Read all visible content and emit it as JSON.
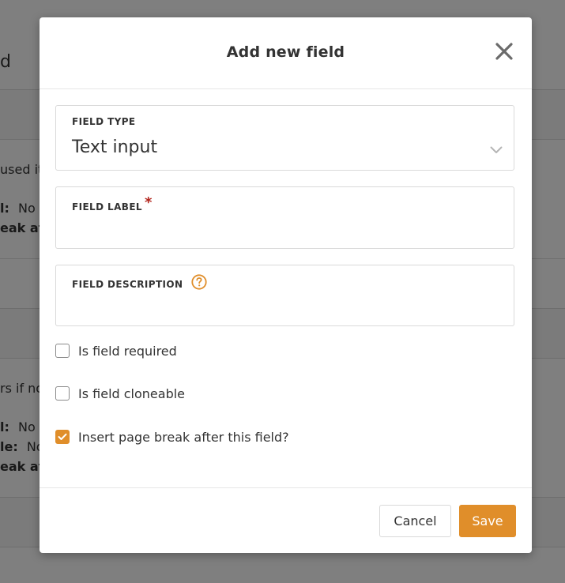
{
  "background": {
    "header_fragment": "d",
    "row1_text": "used it",
    "row1_required_label": "l:",
    "row1_required_value": "No",
    "row1_pagebreak_label": "eak aft",
    "row2_text": "rs if no",
    "row2_required_label": "l:",
    "row2_required_value": "No",
    "row2_cloneable_label": "le:",
    "row2_cloneable_value": "No",
    "row2_pagebreak_label": "eak aft"
  },
  "modal": {
    "title": "Add new field",
    "close_icon": "close-x-icon",
    "field_type": {
      "label": "FIELD TYPE",
      "value": "Text input",
      "icon": "chevron-down-icon"
    },
    "field_label": {
      "label": "FIELD LABEL",
      "required_mark": "*",
      "value": ""
    },
    "field_description": {
      "label": "FIELD DESCRIPTION",
      "help_icon": "question-circle-icon",
      "value": ""
    },
    "checkboxes": [
      {
        "label": "Is field required",
        "checked": false
      },
      {
        "label": "Is field cloneable",
        "checked": false
      },
      {
        "label": "Insert page break after this field?",
        "checked": true
      }
    ],
    "buttons": {
      "cancel": "Cancel",
      "save": "Save"
    }
  },
  "colors": {
    "accent": "#e08e2a",
    "required": "#b3261e",
    "overlay": "rgba(0,0,0,0.5)"
  }
}
